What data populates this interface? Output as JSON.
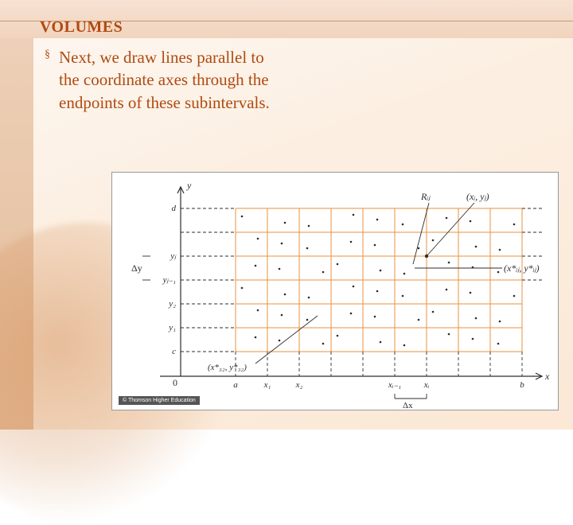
{
  "title": "VOLUMES",
  "bullet": "§",
  "body": "Next, we draw lines parallel to the coordinate axes through the endpoints of these subintervals.",
  "credit": "© Thomson Higher Education",
  "chart_data": {
    "type": "diagram",
    "description": "Partition of a rectangle R=[a,b]×[c,d] into m·n subrectangles R_ij using grid lines through partition points x_i on x-axis and y_j on y-axis, with sample points (x*_ij, y*_ij) in each subrectangle.",
    "x_axis": {
      "label": "x",
      "origin": "0",
      "ticks": [
        "a",
        "x₁",
        "x₂",
        "xᵢ₋₁",
        "xᵢ",
        "b"
      ]
    },
    "y_axis": {
      "label": "y",
      "ticks": [
        "c",
        "y₁",
        "y₂",
        "yⱼ₋₁",
        "yⱼ",
        "d"
      ]
    },
    "annotations": {
      "delta_x": "Δx",
      "delta_y": "Δy",
      "R_ij": "Rᵢⱼ",
      "corner_point": "(xᵢ, yⱼ)",
      "sample_point": "(x*ᵢⱼ, y*ᵢⱼ)",
      "sample_point_32": "(x*₃₂, y*₃₂)"
    },
    "grid": {
      "cols": 9,
      "rows": 6
    },
    "grid_color": "#e8923f",
    "dash_color": "#2d2d2d"
  }
}
